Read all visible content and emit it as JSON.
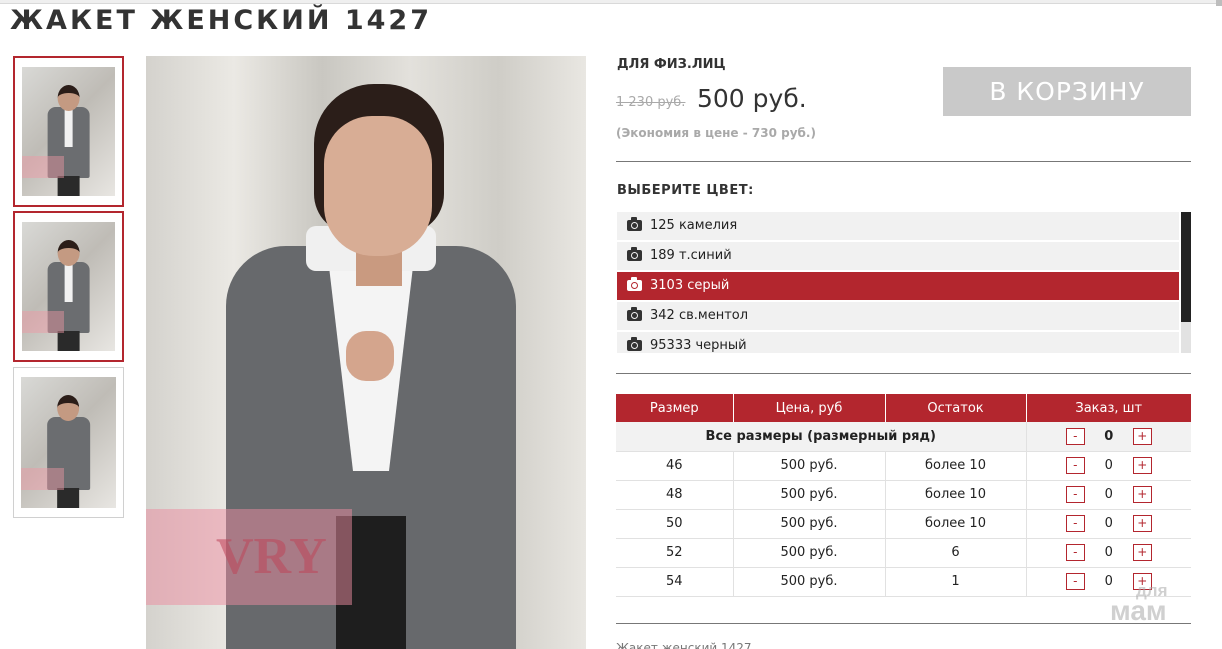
{
  "page_title": "ЖАКЕТ ЖЕНСКИЙ 1427",
  "thumbnails": [
    {
      "name": "thumb-1",
      "active": true
    },
    {
      "name": "thumb-2",
      "active": true
    },
    {
      "name": "thumb-3",
      "active": false
    }
  ],
  "watermark_text": "VRY",
  "price_block": {
    "for_label": "ДЛЯ ФИЗ.ЛИЦ",
    "old_price": "1 230 руб.",
    "new_price": "500 руб.",
    "saving": "(Экономия в цене - 730 руб.)",
    "cart_button": "В КОРЗИНУ"
  },
  "color_section": {
    "heading": "ВЫБЕРИТЕ ЦВЕТ:",
    "items": [
      {
        "label": "125 камелия",
        "selected": false
      },
      {
        "label": "189 т.синий",
        "selected": false
      },
      {
        "label": "3103 серый",
        "selected": true
      },
      {
        "label": "342 св.ментол",
        "selected": false
      },
      {
        "label": "95333 черный",
        "selected": false
      }
    ],
    "icon": "camera-icon"
  },
  "size_table": {
    "headers": [
      "Размер",
      "Цена, руб",
      "Остаток",
      "Заказ, шт"
    ],
    "all_sizes_label": "Все размеры (размерный ряд)",
    "all_sizes_qty": "0",
    "minus": "-",
    "plus": "+",
    "rows": [
      {
        "size": "46",
        "price": "500 руб.",
        "stock": "более 10",
        "qty": "0"
      },
      {
        "size": "48",
        "price": "500 руб.",
        "stock": "более 10",
        "qty": "0"
      },
      {
        "size": "50",
        "price": "500 руб.",
        "stock": "более 10",
        "qty": "0"
      },
      {
        "size": "52",
        "price": "500 руб.",
        "stock": "6",
        "qty": "0"
      },
      {
        "size": "54",
        "price": "500 руб.",
        "stock": "1",
        "qty": "0"
      }
    ]
  },
  "footer_text": "Жакет женский 1427",
  "site_watermark": {
    "top": "для",
    "bottom": "мам"
  },
  "colors": {
    "accent": "#b3262e",
    "cart_button_bg": "#c9c9c9",
    "row_bg": "#f1f1f1"
  }
}
